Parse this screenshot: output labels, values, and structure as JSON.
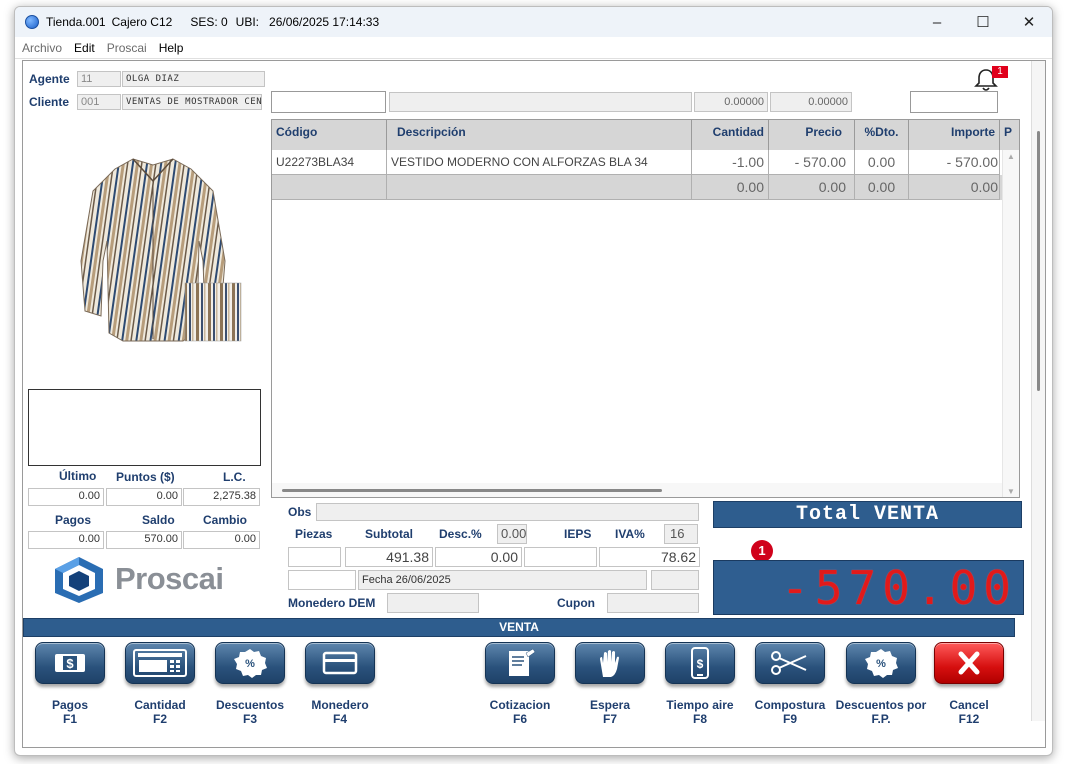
{
  "titlebar": {
    "store": "Tienda.001",
    "cashier": "Cajero C12",
    "session": "SES: 0",
    "ubi": "UBI:",
    "datetime": "26/06/2025 17:14:33"
  },
  "menu": [
    "Archivo",
    "Edit",
    "Proscai",
    "Help"
  ],
  "agent": {
    "label": "Agente",
    "code": "11",
    "name": "OLGA DIAZ"
  },
  "client": {
    "label": "Cliente",
    "code": "001",
    "name": "VENTAS DE MOSTRADOR CEN"
  },
  "notifications": {
    "count": "1"
  },
  "top_inputs": {
    "val1": "0.00000",
    "val2": "0.00000"
  },
  "grid": {
    "columns": [
      "Código",
      "Descripción",
      "Cantidad",
      "Precio",
      "%Dto.",
      "Importe",
      "P"
    ],
    "rows": [
      {
        "codigo": "U22273BLA34",
        "descripcion": "VESTIDO MODERNO CON ALFORZAS BLA 34",
        "cantidad": "-1.00",
        "precio": "- 570.00",
        "dto": "0.00",
        "importe": "- 570.00"
      },
      {
        "codigo": "",
        "descripcion": "",
        "cantidad": "0.00",
        "precio": "0.00",
        "dto": "0.00",
        "importe": "0.00"
      }
    ]
  },
  "stats": {
    "ultimo_label": "Último",
    "puntos_label": "Puntos ($)",
    "lc_label": "L.C.",
    "ultimo": "0.00",
    "puntos": "0.00",
    "lc": "2,275.38",
    "pagos_label": "Pagos",
    "saldo_label": "Saldo",
    "cambio_label": "Cambio",
    "pagos": "0.00",
    "saldo": "570.00",
    "cambio": "0.00"
  },
  "brand": {
    "name": "Proscai"
  },
  "summary": {
    "obs_label": "Obs",
    "piezas_label": "Piezas",
    "subtotal_label": "Subtotal",
    "desc_label": "Desc.%",
    "desc_pct": "0.00",
    "ieps_label": "IEPS",
    "iva_label": "IVA%",
    "iva_pct": "16",
    "subtotal": "491.38",
    "descuento": "0.00",
    "iva": "78.62",
    "fecha": "Fecha 26/06/2025",
    "monedero_label": "Monedero DEM",
    "cupon_label": "Cupon"
  },
  "total": {
    "label": "Total VENTA",
    "amount": "-570.00",
    "badge": "1"
  },
  "mode_bar": "VENTA",
  "function_keys": [
    {
      "label": "Pagos",
      "key": "F1"
    },
    {
      "label": "Cantidad",
      "key": "F2"
    },
    {
      "label": "Descuentos",
      "key": "F3"
    },
    {
      "label": "Monedero",
      "key": "F4"
    },
    {
      "label": "Cotizacion",
      "key": "F6"
    },
    {
      "label": "Espera",
      "key": "F7"
    },
    {
      "label": "Tiempo aire",
      "key": "F8"
    },
    {
      "label": "Compostura",
      "key": "F9"
    },
    {
      "label": "Descuentos por",
      "label2": "F.P."
    },
    {
      "label": "Cancel",
      "key": "F12"
    }
  ]
}
